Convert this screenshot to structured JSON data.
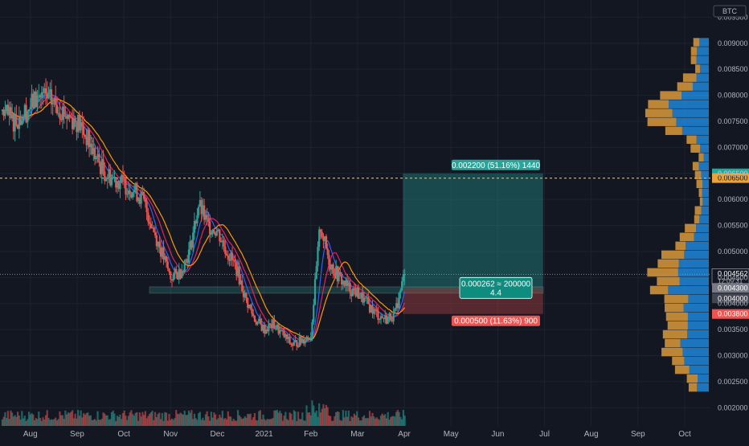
{
  "chart_data": {
    "type": "candlestick",
    "symbol_badge": "BTC",
    "y_axis": {
      "ticks": [
        "0.009500",
        "0.009000",
        "0.008500",
        "0.008000",
        "0.007500",
        "0.007000",
        "0.006500",
        "0.006000",
        "0.005500",
        "0.005000",
        "0.004500",
        "0.004000",
        "0.003500",
        "0.003000",
        "0.002500",
        "0.002000"
      ],
      "tick_values": [
        0.0095,
        0.009,
        0.0085,
        0.008,
        0.0075,
        0.007,
        0.0065,
        0.006,
        0.0055,
        0.005,
        0.0045,
        0.004,
        0.0035,
        0.003,
        0.0025,
        0.002
      ],
      "ylim": [
        0.00165,
        0.00983
      ]
    },
    "x_axis": {
      "labels": [
        "Aug",
        "Sep",
        "Oct",
        "Nov",
        "Dec",
        "2021",
        "Feb",
        "Mar",
        "Apr",
        "May",
        "Jun",
        "Jul",
        "Aug",
        "Sep",
        "Oct"
      ],
      "months_index": [
        0,
        1,
        2,
        3,
        4,
        5,
        6,
        7,
        8,
        9,
        10,
        11,
        12,
        13,
        14
      ],
      "xlim": [
        -0.65,
        14.55
      ]
    },
    "price_labels": {
      "target": {
        "text": "0.006500",
        "value": 0.0065,
        "color": "#26a69a"
      },
      "target_line": {
        "text": "0.006500",
        "value": 0.00641,
        "color": "#e8a33d"
      },
      "last": {
        "text": "0.004562",
        "value": 0.004562,
        "countdown": "12:09:31"
      },
      "entry": {
        "text": "0.004300",
        "value": 0.0043
      },
      "mid": {
        "text": "0.004000",
        "value": 0.0041
      },
      "stop": {
        "text": "0.003800",
        "value": 0.0038,
        "color": "#ef5350"
      }
    },
    "position": {
      "entry": 0.0043,
      "target": 0.0065,
      "stop": 0.0038,
      "x_start": 7.97,
      "x_end": 10.97,
      "target_label": "0.002200 (51.16%) 1440",
      "stop_label": "0.000500 (11.63%) 900",
      "center_line1": "0.000262 ≈ 200000",
      "center_line2": "4.4"
    },
    "support_zone": {
      "low": 0.0042,
      "high": 0.00432,
      "x_start": 2.55,
      "x_end": 10.97
    },
    "resistance_line": 0.00641,
    "colors": {
      "up": "#26a69a",
      "down": "#ef5350",
      "up_wick": "#26a69a",
      "ma_fast": "#2962ff",
      "ma_mid": "#e91e63",
      "ma_slow": "#ff9800",
      "vp_up": "#2196f3",
      "vp_down": "#e8a33d"
    },
    "series": [
      {
        "name": "",
        "type": "close",
        "x": [
          -0.6,
          -0.4,
          -0.2,
          0,
          0.2,
          0.4,
          0.6,
          0.8,
          1,
          1.2,
          1.4,
          1.6,
          1.8,
          2,
          2.2,
          2.4,
          2.6,
          2.8,
          3,
          3.2,
          3.4,
          3.6,
          3.8,
          4,
          4.2,
          4.4,
          4.6,
          4.8,
          5,
          5.2,
          5.4,
          5.6,
          5.8,
          6,
          6.2,
          6.4,
          6.6,
          6.8,
          7,
          7.2,
          7.4,
          7.6,
          7.8,
          8
        ],
        "values": [
          0.0077,
          0.0075,
          0.0076,
          0.0078,
          0.008,
          0.0079,
          0.0078,
          0.0076,
          0.0075,
          0.0072,
          0.0068,
          0.0065,
          0.0064,
          0.0063,
          0.0062,
          0.006,
          0.0055,
          0.005,
          0.0045,
          0.0046,
          0.005,
          0.0059,
          0.0055,
          0.0054,
          0.005,
          0.0047,
          0.0041,
          0.0037,
          0.0035,
          0.0036,
          0.0034,
          0.0032,
          0.0033,
          0.0034,
          0.0055,
          0.0048,
          0.0045,
          0.0043,
          0.0042,
          0.004,
          0.0038,
          0.0037,
          0.0038,
          0.004562
        ]
      }
    ],
    "volume_profile_levels": 40
  }
}
